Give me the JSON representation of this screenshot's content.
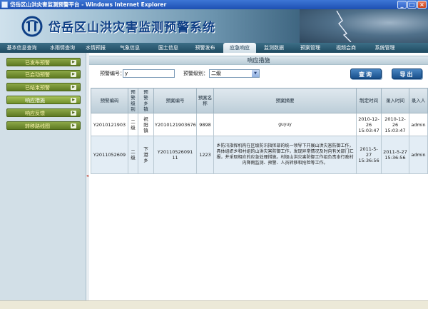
{
  "window": {
    "title": "岱岳区山洪灾害监测预警平台 - Windows Internet Explorer",
    "minimize": "_",
    "maximize": "□",
    "close": "×"
  },
  "banner": {
    "title": "岱岳区山洪灾害监测预警系统"
  },
  "nav": [
    {
      "label": "基本信息查询"
    },
    {
      "label": "水雨情查询"
    },
    {
      "label": "水情预报"
    },
    {
      "label": "气象信息"
    },
    {
      "label": "国土信息"
    },
    {
      "label": "预警发布"
    },
    {
      "label": "应急响应"
    },
    {
      "label": "监测数据"
    },
    {
      "label": "预案管理"
    },
    {
      "label": "视频会商"
    },
    {
      "label": "系统管理"
    }
  ],
  "sidebar": {
    "items": [
      {
        "label": "已发布预警"
      },
      {
        "label": "已启动预警"
      },
      {
        "label": "已结束预警"
      },
      {
        "label": "响应措施"
      },
      {
        "label": "响应反馈"
      },
      {
        "label": "转移路线图"
      }
    ],
    "collapse_arrow": "◂"
  },
  "content": {
    "header": "响应措施",
    "search": {
      "code_label": "预警编号：",
      "code_value": "y",
      "level_label": "预警级别：",
      "level_value": "二级",
      "query_button": "查询",
      "export_button": "导出"
    },
    "table": {
      "headers": {
        "code": "预警编码",
        "level": "预警级别",
        "town": "预警乡镇",
        "plan_code": "预案编号",
        "plan_name": "预案名称",
        "summary": "预案摘要",
        "create_time": "制定时间",
        "entry_time": "录入时间",
        "entry_person": "录入人"
      },
      "rows": [
        {
          "code": "Y2010121903",
          "level": "二级",
          "town": "祝阳镇",
          "plan_code": "Y20101219036765",
          "plan_name": "9898",
          "summary": "guyuy",
          "create_time": "2010-12-26 15:03:47",
          "entry_time": "2010-12-26 15:03:47",
          "entry_person": "admin"
        },
        {
          "code": "Y2011052609",
          "level": "二级",
          "town": "下港乡",
          "plan_code": "Y20110526091 11",
          "plan_name": "1223",
          "summary": "乡防汛指挥机构在区级防汛指挥部的统一领导下开展山洪灾害防御工作，具体组织乡和村组的山洪灾害防御工作，发现异常情况及时向有关部门汇报，并采取相应的应急处理措施。村级山洪灾害防御工作组负责本行政村内降雨监测、预警、人员转移和抢险等工作。",
          "create_time": "2011-5-27 15:36:56",
          "entry_time": "2011-5-27 15:36:56",
          "entry_person": "admin"
        }
      ]
    }
  },
  "colors": {
    "nav_bg": "#1f4a61",
    "sidebar_btn": "#6f8f2a",
    "action_btn": "#174f8b",
    "link": "#1c4aa3"
  }
}
